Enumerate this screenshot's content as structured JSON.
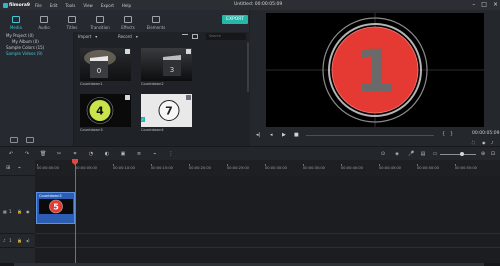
{
  "app": {
    "logo_text": "filmora9",
    "menu": [
      "File",
      "Edit",
      "Tools",
      "View",
      "Export",
      "Help"
    ],
    "title": "Untitled:",
    "title_time": "00:00:05:09"
  },
  "media_tabs": [
    {
      "label": "Media",
      "active": true
    },
    {
      "label": "Audio",
      "active": false
    },
    {
      "label": "Titles",
      "active": false
    },
    {
      "label": "Transition",
      "active": false
    },
    {
      "label": "Effects",
      "active": false
    },
    {
      "label": "Elements",
      "active": false
    }
  ],
  "export_label": "EXPORT",
  "tree": {
    "project": "My Project (0)",
    "album": "My Album (0)",
    "sample_colors": "Sample Colors (15)",
    "sample_videos": "Sample Videos (9)"
  },
  "library": {
    "import_label": "Import",
    "record_label": "Record",
    "search_placeholder": "Search",
    "items": [
      {
        "label": "Countdown1",
        "digit": "0"
      },
      {
        "label": "Countdown2",
        "digit": "3"
      },
      {
        "label": "Countdown3",
        "digit": "4"
      },
      {
        "label": "Countdown4",
        "digit": "7"
      }
    ]
  },
  "preview": {
    "digit": "1",
    "time": "00:00:05:09"
  },
  "timeline": {
    "ruler_labels": [
      "00:00:00:00",
      "00:00:05:00",
      "00:00:10:00",
      "00:00:15:00",
      "00:00:20:00",
      "00:00:25:00",
      "00:00:30:00",
      "00:00:35:00",
      "00:00:40:00",
      "00:00:45:00",
      "00:00:50:00",
      "00:00:55:00"
    ],
    "clip_label": "Countdown3",
    "clip_digit": "5",
    "video_track_label": "1",
    "audio_track_label": "1"
  },
  "colors": {
    "accent": "#45c4d1",
    "export": "#25b7a8",
    "playhead": "#e0483f",
    "clip": "#2b5db4",
    "countdown_red": "#e53a33"
  }
}
